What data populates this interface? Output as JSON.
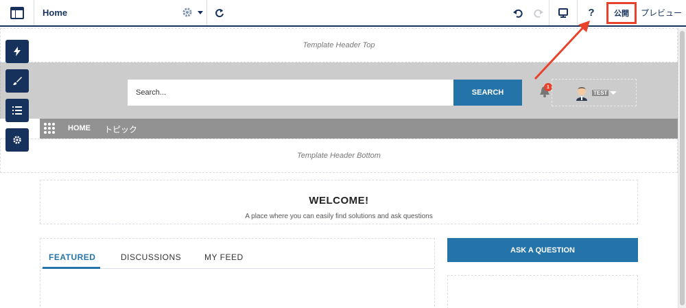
{
  "toolbar": {
    "page_label": "Home",
    "help_label": "?",
    "publish_label": "公開",
    "preview_label": "プレビュー",
    "icons": [
      "layout-icon",
      "gear-icon",
      "caret-down-icon",
      "redo-refresh-icon",
      "undo-icon",
      "redo-icon",
      "desktop-icon"
    ]
  },
  "side_tools": [
    "lightning-icon",
    "brush-icon",
    "list-icon",
    "gear-icon"
  ],
  "template": {
    "header_top": "Template Header Top",
    "header_bottom": "Template Header Bottom"
  },
  "search": {
    "placeholder": "Search...",
    "button_label": "SEARCH"
  },
  "notifications": {
    "count": "1"
  },
  "user": {
    "name": "TEST"
  },
  "nav": {
    "items": [
      "HOME",
      "トピック"
    ]
  },
  "welcome": {
    "title": "WELCOME!",
    "subtitle": "A place where you can easily find solutions and ask questions"
  },
  "tabs": [
    "FEATURED",
    "DISCUSSIONS",
    "MY FEED"
  ],
  "ask_button": "ASK A QUESTION",
  "colors": {
    "navy": "#16325c",
    "accent": "#2574a9",
    "highlight": "#e8412c"
  }
}
